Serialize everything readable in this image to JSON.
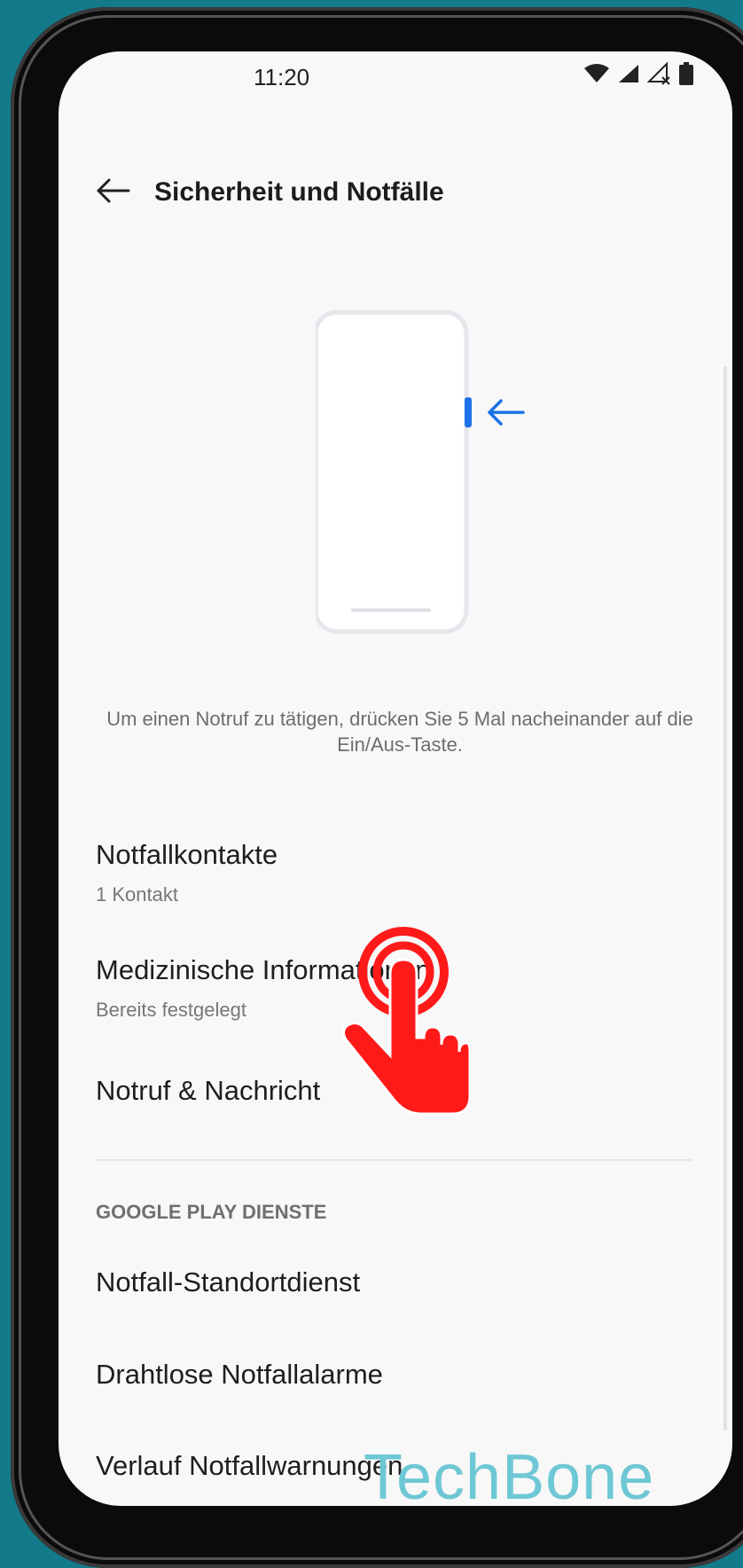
{
  "status_bar": {
    "time": "11:20",
    "icons": [
      "wifi-icon",
      "signal-icon",
      "signal-no-sim-icon",
      "battery-icon"
    ]
  },
  "header": {
    "back_icon": "back-arrow-icon",
    "title": "Sicherheit und Notfälle"
  },
  "illustration": {
    "icon": "phone-power-button-illustration",
    "accent_color": "#1a73e8"
  },
  "description": "Um einen Notruf zu tätigen, drücken Sie 5 Mal nacheinander auf die Ein/Aus-Taste.",
  "items": [
    {
      "title": "Notfallkontakte",
      "subtitle": "1 Kontakt"
    },
    {
      "title": "Medizinische Informationen",
      "subtitle": "Bereits festgelegt"
    },
    {
      "title": "Notruf & Nachricht"
    }
  ],
  "section": {
    "header": "GOOGLE PLAY DIENSTE",
    "items": [
      {
        "title": "Notfall-Standortdienst"
      },
      {
        "title": "Drahtlose Notfallalarme"
      },
      {
        "title": "Verlauf Notfallwarnungen"
      }
    ]
  },
  "overlay": {
    "tap_icon": "tap-hand-icon",
    "tap_color": "#ff1a1a",
    "watermark": "TechBone"
  },
  "colors": {
    "background": "#137a8a",
    "screen": "#f8f8f8"
  }
}
